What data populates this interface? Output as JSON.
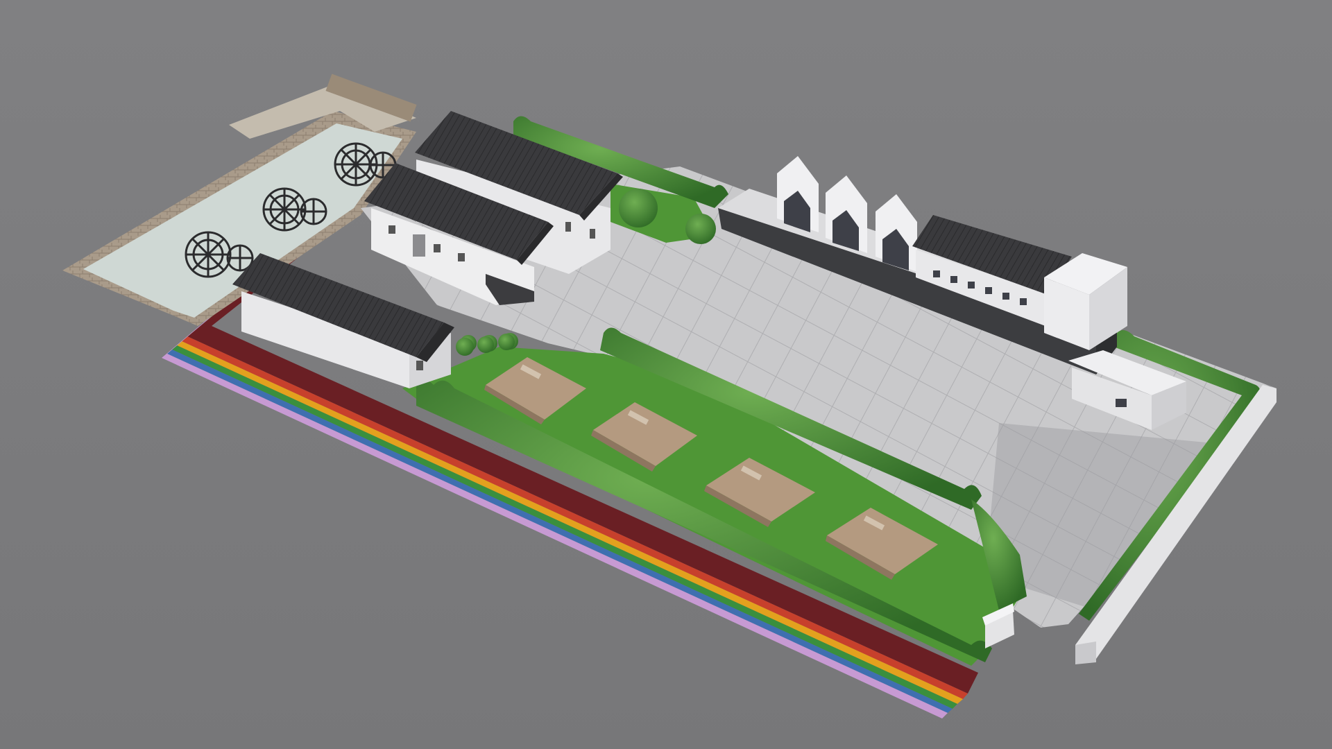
{
  "scene": {
    "kind": "aerial-architectural-render",
    "colors": {
      "background": "#7c7c7e",
      "plaza_paving": "#c9c9cb",
      "paving_joint": "#aeaeb1",
      "lawn": "#4f9636",
      "hedge": "#3f7d2f",
      "water": "#cfd8d4",
      "wall_white": "#e8e8ea",
      "roof_tile": "#3a3a3d",
      "thatch": "#b49a80",
      "rainbow_track": [
        "#6a1f24",
        "#c7402c",
        "#e3a11e",
        "#3a8f3e",
        "#3f6fb0",
        "#c79ad3"
      ]
    },
    "objects": {
      "water_wheels": 6,
      "thatched_pavilions": 4,
      "chinese_roof_buildings": 3,
      "gabled_modern_building": 1,
      "rainbow_running_track": 1
    }
  }
}
